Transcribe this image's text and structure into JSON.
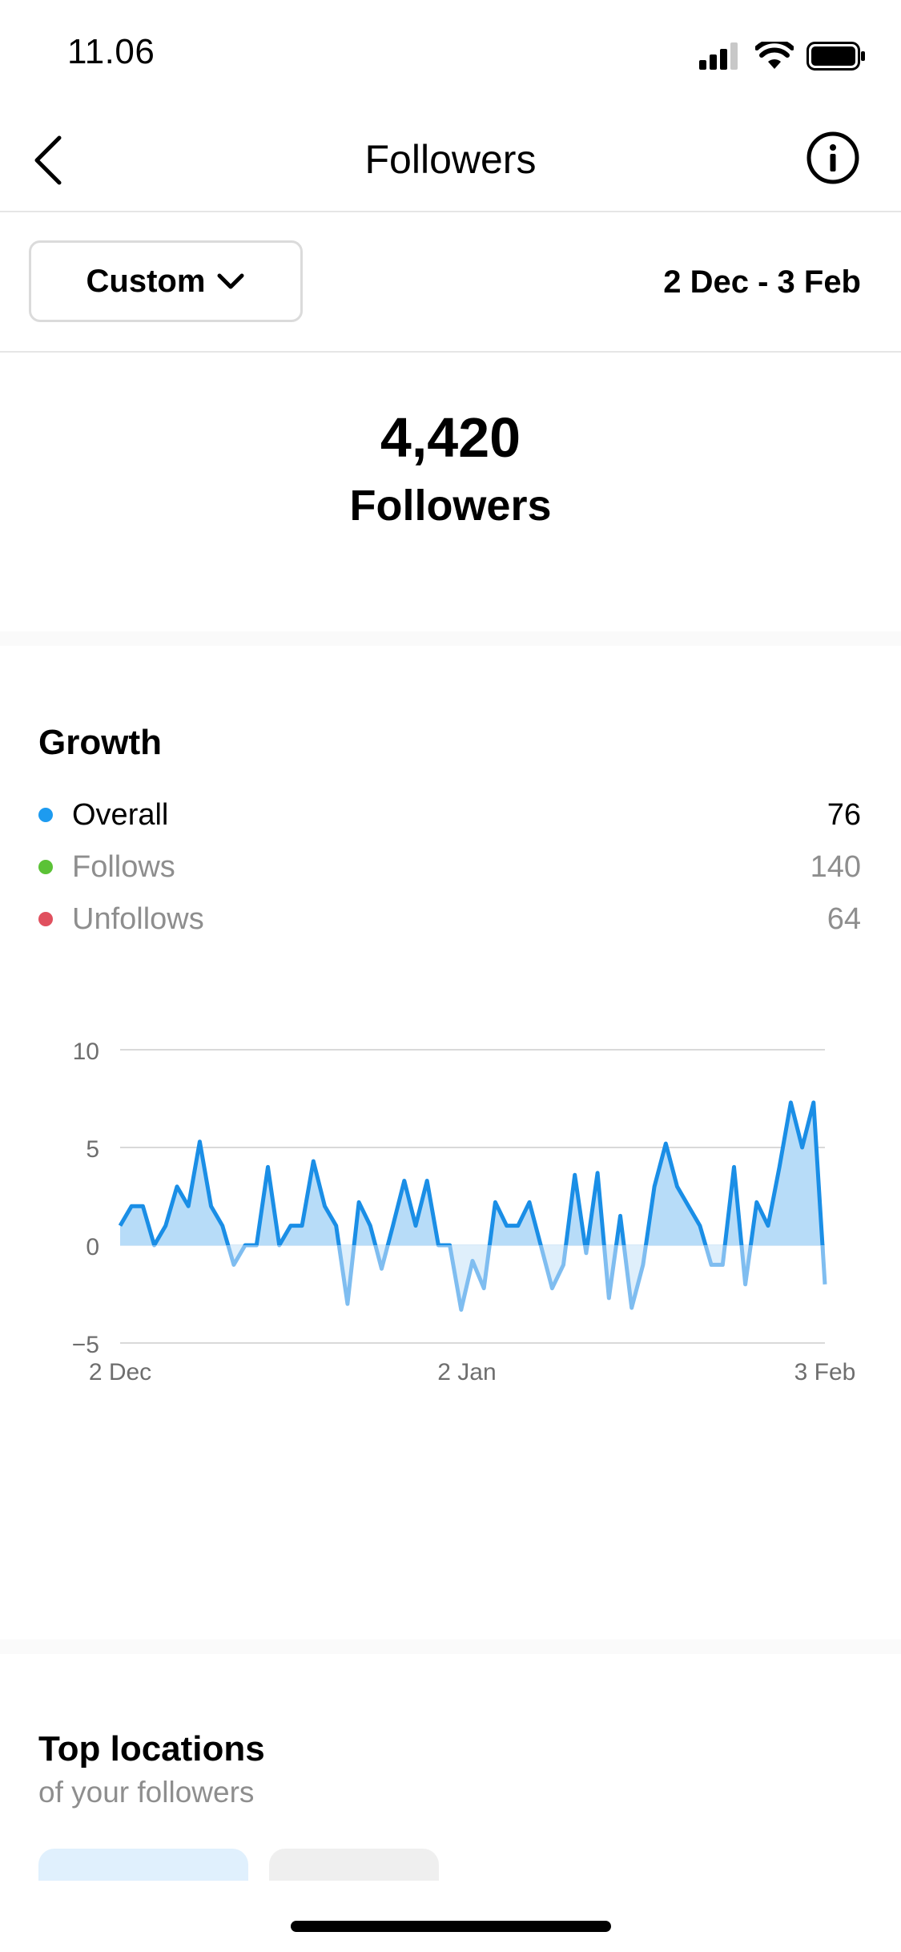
{
  "status_bar": {
    "time": "11.06"
  },
  "nav": {
    "title": "Followers"
  },
  "filter": {
    "range_button": "Custom",
    "date_range": "2 Dec - 3 Feb"
  },
  "summary": {
    "count": "4,420",
    "label": "Followers"
  },
  "growth": {
    "title": "Growth",
    "legend": [
      {
        "label": "Overall",
        "value": "76",
        "color": "#1d9bf0"
      },
      {
        "label": "Follows",
        "value": "140",
        "color": "#5bc236"
      },
      {
        "label": "Unfollows",
        "value": "64",
        "color": "#e0505e"
      }
    ]
  },
  "chart_data": {
    "type": "area",
    "x_tick_labels": [
      "2 Dec",
      "2 Jan",
      "3 Feb"
    ],
    "y_ticks": [
      10,
      5,
      0,
      -5
    ],
    "ylim": [
      -5,
      10
    ],
    "grid": true,
    "series": [
      {
        "color": "#1a8ee6",
        "values": [
          1,
          2,
          2,
          0,
          1,
          3,
          2,
          5.3,
          2,
          1,
          -1,
          0,
          0,
          4,
          0,
          1,
          1,
          4.3,
          2,
          1,
          -3,
          2.2,
          1,
          -1.2,
          1,
          3.3,
          1,
          3.3,
          0,
          0,
          -3.3,
          -0.8,
          -2.2,
          2.2,
          1,
          1,
          2.2,
          0,
          -2.2,
          -1,
          3.6,
          -0.4,
          3.7,
          -2.7,
          1.5,
          -3.2,
          -1,
          3,
          5.2,
          3,
          2,
          1,
          -1,
          -1,
          4,
          -2,
          2.2,
          1,
          4,
          7.3,
          5,
          7.3,
          -2
        ]
      }
    ]
  },
  "locations": {
    "title": "Top locations",
    "subtitle": "of your followers"
  },
  "colors": {
    "accent": "#1a8ee6",
    "area_fill": "#b7dcf8",
    "area_fill_negative": "#dfeffb",
    "muted_text": "#8e8e8e"
  }
}
